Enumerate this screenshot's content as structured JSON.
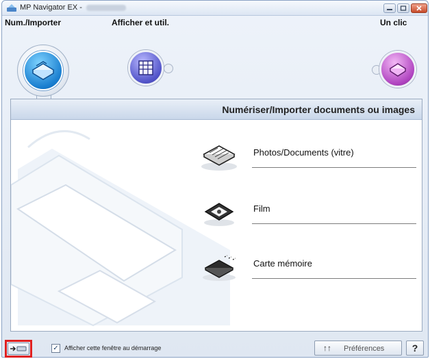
{
  "window": {
    "title": "MP Navigator EX -",
    "title_suffix_blurred": true,
    "controls": [
      "minimize",
      "maximize",
      "close"
    ]
  },
  "modes": [
    {
      "label": "Num./Importer",
      "icon": "scanner-icon",
      "active": true
    },
    {
      "label": "Afficher et util.",
      "icon": "view-use-icon",
      "active": false
    },
    {
      "label": "Un clic",
      "icon": "one-click-icon",
      "active": false
    }
  ],
  "panel": {
    "title": "Numériser/Importer documents ou images",
    "items": [
      {
        "label": "Photos/Documents (vitre)",
        "icon": "photos-documents-icon"
      },
      {
        "label": "Film",
        "icon": "film-icon"
      },
      {
        "label": "Carte mémoire",
        "icon": "memory-card-icon"
      }
    ]
  },
  "bottom": {
    "toggle_icon": "arrow-right-icon",
    "show_at_startup_label": "Afficher cette fenêtre au démarrage",
    "show_at_startup_checked": true,
    "preferences_label": "Préférences",
    "preferences_icon": "preferences-icon",
    "help_label": "?"
  },
  "colors": {
    "highlight": "#e02020",
    "scan_mode": "#1a7fd0",
    "view_mode": "#5254c9",
    "oneclick_mode": "#b044c0"
  }
}
